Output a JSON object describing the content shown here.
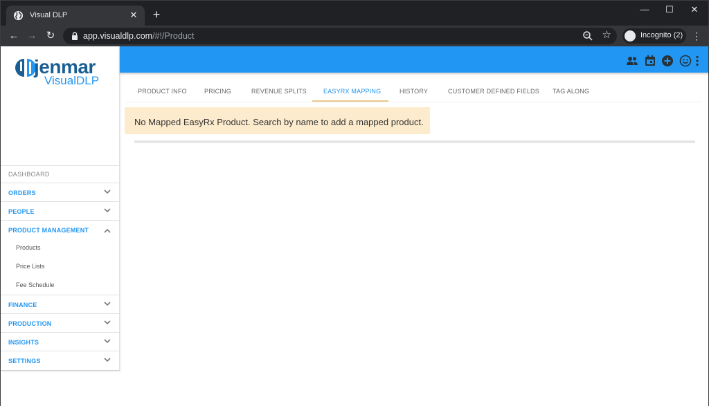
{
  "browser": {
    "tab_title": "Visual DLP",
    "url_host": "app.visualdlp.com",
    "url_path": "/#!/Product",
    "incognito_label": "Incognito (2)"
  },
  "logo": {
    "brand": "jenmar",
    "sub": "VisualDLP"
  },
  "sidebar": {
    "dashboard": "DASHBOARD",
    "items": [
      {
        "label": "ORDERS",
        "expanded": false
      },
      {
        "label": "PEOPLE",
        "expanded": false
      },
      {
        "label": "PRODUCT MANAGEMENT",
        "expanded": true,
        "children": [
          "Products",
          "Price Lists",
          "Fee Schedule"
        ]
      },
      {
        "label": "FINANCE",
        "expanded": false
      },
      {
        "label": "PRODUCTION",
        "expanded": false
      },
      {
        "label": "INSIGHTS",
        "expanded": false
      },
      {
        "label": "SETTINGS",
        "expanded": false
      }
    ]
  },
  "appbar": {
    "icons": [
      "people-icon",
      "calendar-icon",
      "add-circle-icon",
      "smiley-icon",
      "more-vert-icon"
    ],
    "color": "#2196f3"
  },
  "tabs": {
    "items": [
      "PRODUCT INFO",
      "PRICING",
      "REVENUE SPLITS",
      "EASYRX MAPPING",
      "HISTORY",
      "CUSTOMER DEFINED FIELDS",
      "TAG ALONG"
    ],
    "active": "EASYRX MAPPING"
  },
  "alert": {
    "message": "No Mapped EasyRx Product. Search by name to add a mapped product."
  }
}
